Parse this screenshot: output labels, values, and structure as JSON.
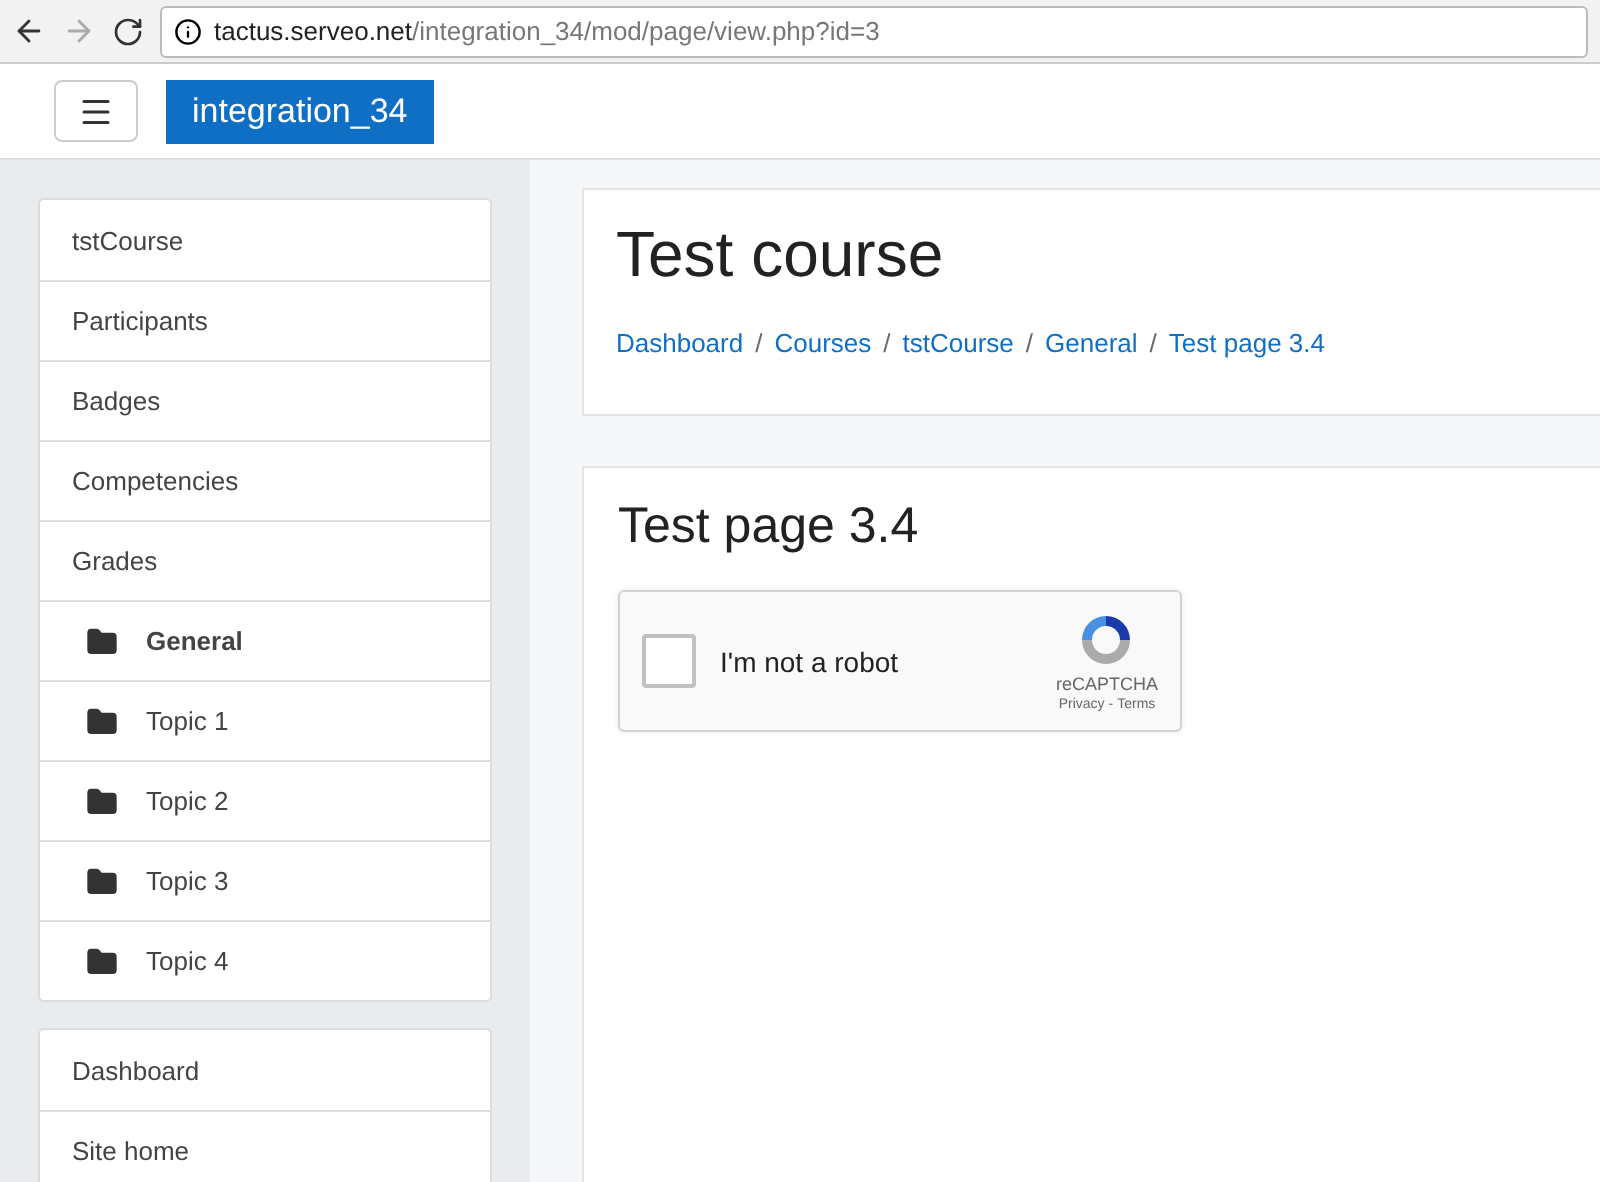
{
  "browser": {
    "url_host": "tactus.serveo.net",
    "url_path": "/integration_34/mod/page/view.php?id=3"
  },
  "navbar": {
    "site_name": "integration_34"
  },
  "sidebar": {
    "groups": [
      {
        "items": [
          {
            "label": "tstCourse",
            "kind": "link",
            "selected": false
          },
          {
            "label": "Participants",
            "kind": "link",
            "selected": false
          },
          {
            "label": "Badges",
            "kind": "link",
            "selected": false
          },
          {
            "label": "Competencies",
            "kind": "link",
            "selected": false
          },
          {
            "label": "Grades",
            "kind": "link",
            "selected": false
          },
          {
            "label": "General",
            "kind": "section",
            "selected": true
          },
          {
            "label": "Topic 1",
            "kind": "section",
            "selected": false
          },
          {
            "label": "Topic 2",
            "kind": "section",
            "selected": false
          },
          {
            "label": "Topic 3",
            "kind": "section",
            "selected": false
          },
          {
            "label": "Topic 4",
            "kind": "section",
            "selected": false
          }
        ]
      },
      {
        "items": [
          {
            "label": "Dashboard",
            "kind": "link",
            "selected": false
          },
          {
            "label": "Site home",
            "kind": "link",
            "selected": false
          }
        ]
      }
    ]
  },
  "header": {
    "title": "Test course",
    "breadcrumb_separator": "/",
    "breadcrumb": [
      "Dashboard",
      "Courses",
      "tstCourse",
      "General",
      "Test page 3.4"
    ]
  },
  "content": {
    "title": "Test page 3.4",
    "captcha": {
      "label": "I'm not a robot",
      "checked": false,
      "brand": "reCAPTCHA",
      "privacy": "Privacy",
      "separator": "-",
      "terms": "Terms"
    }
  }
}
